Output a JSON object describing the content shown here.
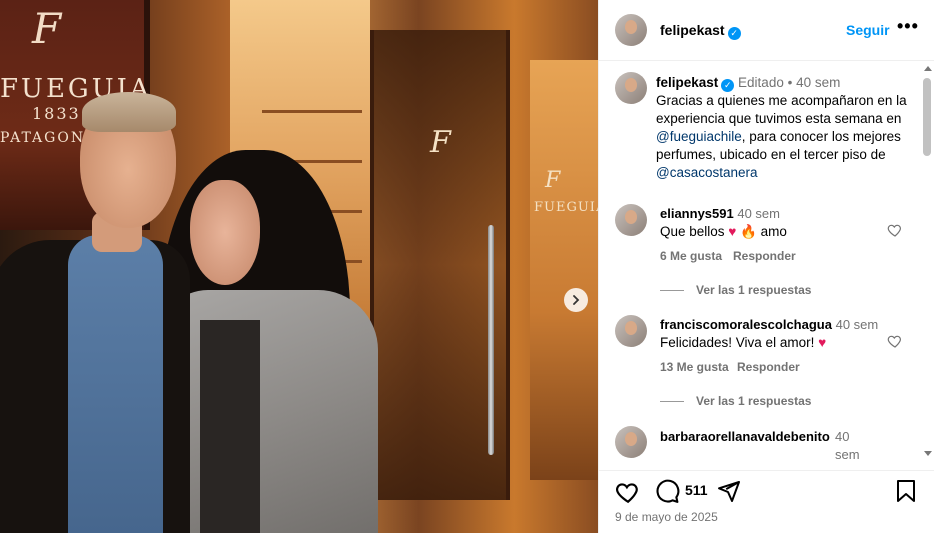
{
  "photo": {
    "sign": {
      "logo": "F",
      "brand": "FUEGUIA",
      "year": "1833",
      "place": "PATAGONI"
    },
    "next_icon": "chevron-right-icon"
  },
  "header": {
    "username": "felipekast",
    "follow_label": "Seguir",
    "more_label": "•••"
  },
  "caption": {
    "username": "felipekast",
    "edited": "Editado",
    "separator": "•",
    "time": "40 sem",
    "text_1": "Gracias a quienes me acompañaron en la experiencia  que tuvimos esta semana en ",
    "mention_1": "@fueguiachile",
    "text_2": ", para conocer los mejores perfumes, ubicado en el tercer piso de ",
    "mention_2": "@casacostanera"
  },
  "comments": [
    {
      "user": "eliannys591",
      "time": "40 sem",
      "text_before": "Que bellos ",
      "emoji_1": "♥",
      "emoji_2": "🔥",
      "text_after": " amo",
      "likes": "6 Me gusta",
      "reply": "Responder",
      "replies": "Ver las 1 respuestas"
    },
    {
      "user": "franciscomoralescolchagua",
      "time": "40 sem",
      "text_before": "Felicidades! Viva el amor! ",
      "emoji_1": "♥",
      "likes": "13 Me gusta",
      "reply": "Responder",
      "replies": "Ver las 1 respuestas"
    },
    {
      "user": "barbaraorellanavaldebenito",
      "time": "40 sem"
    }
  ],
  "actions": {
    "like_icon": "heart-icon",
    "comment_icon": "comment-icon",
    "count": "511",
    "share_icon": "send-icon",
    "save_icon": "bookmark-icon"
  },
  "date": "9 de mayo de 2025",
  "colors": {
    "accent": "#0095f6",
    "verified": "#0095f6",
    "heart": "#e21a5c",
    "mention": "#00376b",
    "muted": "#737373"
  }
}
